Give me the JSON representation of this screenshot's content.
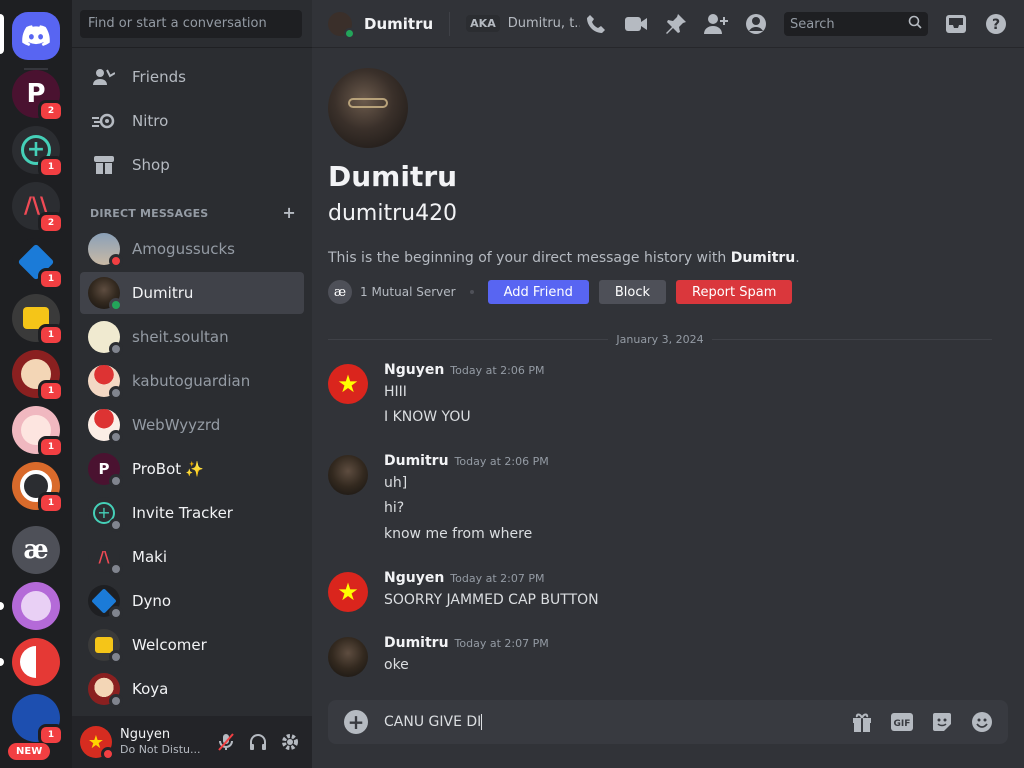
{
  "rail": {
    "servers": [
      {
        "name": "discord-home",
        "badge": ""
      },
      {
        "name": "probot",
        "badge": "2"
      },
      {
        "name": "invite-tracker",
        "badge": "1"
      },
      {
        "name": "maki",
        "badge": "2"
      },
      {
        "name": "dyno",
        "badge": "1"
      },
      {
        "name": "welcomer",
        "badge": "1"
      },
      {
        "name": "koya",
        "badge": "1"
      },
      {
        "name": "anime-girl",
        "badge": "1"
      },
      {
        "name": "owl",
        "badge": "1"
      },
      {
        "name": "mutual-server",
        "badge": ""
      },
      {
        "name": "purple-server",
        "badge": ""
      },
      {
        "name": "yin-yang-server",
        "badge": ""
      },
      {
        "name": "blue-server",
        "badge": "1"
      }
    ],
    "new_label": "NEW"
  },
  "sidebar": {
    "search_placeholder": "Find or start a conversation",
    "nav": [
      {
        "label": "Friends",
        "icon": "friends-icon"
      },
      {
        "label": "Nitro",
        "icon": "nitro-icon"
      },
      {
        "label": "Shop",
        "icon": "shop-icon"
      }
    ],
    "dm_header": "DIRECT MESSAGES",
    "dms": [
      {
        "name": "Amogussucks",
        "status": "dnd",
        "active": false
      },
      {
        "name": "Dumitru",
        "status": "online",
        "active": true
      },
      {
        "name": "sheit.soultan",
        "status": "offline",
        "active": false
      },
      {
        "name": "kabutoguardian",
        "status": "offline",
        "active": false
      },
      {
        "name": "WebWyyzrd",
        "status": "offline",
        "active": false
      },
      {
        "name": "ProBot",
        "status": "offline",
        "active": false,
        "sparkle": "✨"
      },
      {
        "name": "Invite Tracker",
        "status": "offline",
        "active": false
      },
      {
        "name": "Maki",
        "status": "offline",
        "active": false
      },
      {
        "name": "Dyno",
        "status": "offline",
        "active": false
      },
      {
        "name": "Welcomer",
        "status": "offline",
        "active": false
      },
      {
        "name": "Koya",
        "status": "offline",
        "active": false
      }
    ],
    "user": {
      "name": "Nguyen",
      "status": "Do Not Distu..."
    }
  },
  "topbar": {
    "name": "Dumitru",
    "aka_label": "AKA",
    "aka_text": "Dumitru, t...",
    "search_placeholder": "Search"
  },
  "intro": {
    "display_name": "Dumitru",
    "username": "dumitru420",
    "text_prefix": "This is the beginning of your direct message history with ",
    "text_name": "Dumitru",
    "text_suffix": ".",
    "mutual": "1 Mutual Server",
    "mutual_icon_text": "æ",
    "add_friend": "Add Friend",
    "block": "Block",
    "report": "Report Spam"
  },
  "date_divider": "January 3, 2024",
  "messages": [
    {
      "author": "Nguyen",
      "time": "Today at 2:06 PM",
      "lines": [
        "HIII",
        "I KNOW YOU"
      ],
      "avatar": "flag"
    },
    {
      "author": "Dumitru",
      "time": "Today at 2:06 PM",
      "lines": [
        "uh]",
        "hi?",
        "know me from where"
      ],
      "avatar": "face"
    },
    {
      "author": "Nguyen",
      "time": "Today at 2:07 PM",
      "lines": [
        "SOORRY JAMMED CAP BUTTON"
      ],
      "avatar": "flag"
    },
    {
      "author": "Dumitru",
      "time": "Today at 2:07 PM",
      "lines": [
        "oke"
      ],
      "avatar": "face"
    }
  ],
  "composer": {
    "value": "CANU GIVE DI"
  },
  "colors": {
    "blurple": "#5865f2",
    "red": "#da373c",
    "online": "#23a55a",
    "dnd": "#f23f42",
    "offline": "#80848e"
  }
}
